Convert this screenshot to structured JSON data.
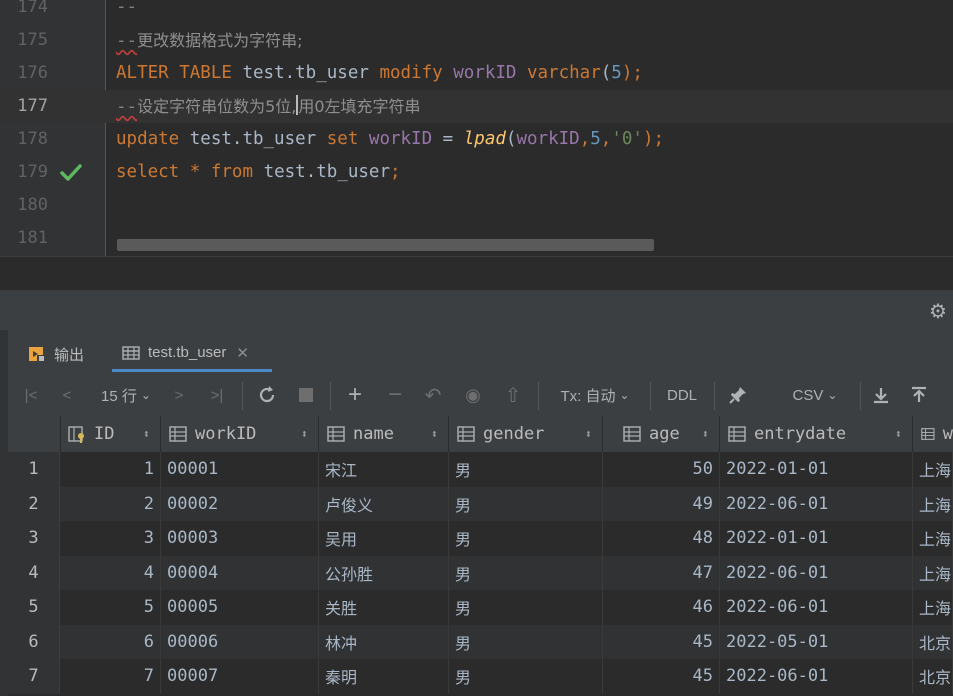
{
  "editor": {
    "lines": [
      {
        "num": "174",
        "text": "--"
      },
      {
        "num": "175",
        "prefix": "--",
        "comment": "更改数据格式为字符串;"
      },
      {
        "num": "176",
        "tokens": {
          "k1": "ALTER",
          "k2": "TABLE",
          "tbl": "test.tb_user",
          "k3": "modify",
          "col": "workID",
          "type": "varchar",
          "lp": "(",
          "n": "5",
          "rp": ");"
        }
      },
      {
        "num": "177",
        "prefix": "--",
        "comment_a": "设定字符串位数为5位,",
        "comment_b": "用0左填充字符串"
      },
      {
        "num": "178",
        "tokens": {
          "k1": "update",
          "tbl": "test.tb_user",
          "k2": "set",
          "col": "workID",
          "eq": "=",
          "fn": "lpad",
          "lp": "(",
          "arg1": "workID",
          "c1": ",",
          "n": "5",
          "c2": ",",
          "s": "'0'",
          "rp": ");"
        }
      },
      {
        "num": "179",
        "tokens": {
          "k1": "select",
          "star": "*",
          "k2": "from",
          "tbl": "test.tb_user",
          "semi": ";"
        }
      },
      {
        "num": "180"
      },
      {
        "num": "181"
      }
    ]
  },
  "tool": {
    "tabs": [
      {
        "label": "输出"
      },
      {
        "label": "test.tb_user"
      }
    ],
    "toolbar": {
      "rows_label": "15 行",
      "tx_label": "Tx: 自动",
      "ddl_label": "DDL",
      "csv_label": "CSV"
    }
  },
  "grid": {
    "columns": [
      {
        "label": "ID"
      },
      {
        "label": "workID"
      },
      {
        "label": "name"
      },
      {
        "label": "gender"
      },
      {
        "label": "age"
      },
      {
        "label": "entrydate"
      },
      {
        "label": "w"
      }
    ],
    "rows": [
      {
        "n": "1",
        "id": "1",
        "workid": "00001",
        "name": "宋江",
        "gender": "男",
        "age": "50",
        "entrydate": "2022-01-01",
        "w": "上海"
      },
      {
        "n": "2",
        "id": "2",
        "workid": "00002",
        "name": "卢俊义",
        "gender": "男",
        "age": "49",
        "entrydate": "2022-06-01",
        "w": "上海"
      },
      {
        "n": "3",
        "id": "3",
        "workid": "00003",
        "name": "吴用",
        "gender": "男",
        "age": "48",
        "entrydate": "2022-01-01",
        "w": "上海"
      },
      {
        "n": "4",
        "id": "4",
        "workid": "00004",
        "name": "公孙胜",
        "gender": "男",
        "age": "47",
        "entrydate": "2022-06-01",
        "w": "上海"
      },
      {
        "n": "5",
        "id": "5",
        "workid": "00005",
        "name": "关胜",
        "gender": "男",
        "age": "46",
        "entrydate": "2022-06-01",
        "w": "上海"
      },
      {
        "n": "6",
        "id": "6",
        "workid": "00006",
        "name": "林冲",
        "gender": "男",
        "age": "45",
        "entrydate": "2022-05-01",
        "w": "北京"
      },
      {
        "n": "7",
        "id": "7",
        "workid": "00007",
        "name": "秦明",
        "gender": "男",
        "age": "45",
        "entrydate": "2022-06-01",
        "w": "北京"
      }
    ]
  },
  "colors": {
    "keyword": "#cc7832",
    "field": "#9876aa",
    "number": "#6897bb",
    "string": "#6a8759",
    "function": "#ffc66d",
    "check": "#5fb85f"
  }
}
